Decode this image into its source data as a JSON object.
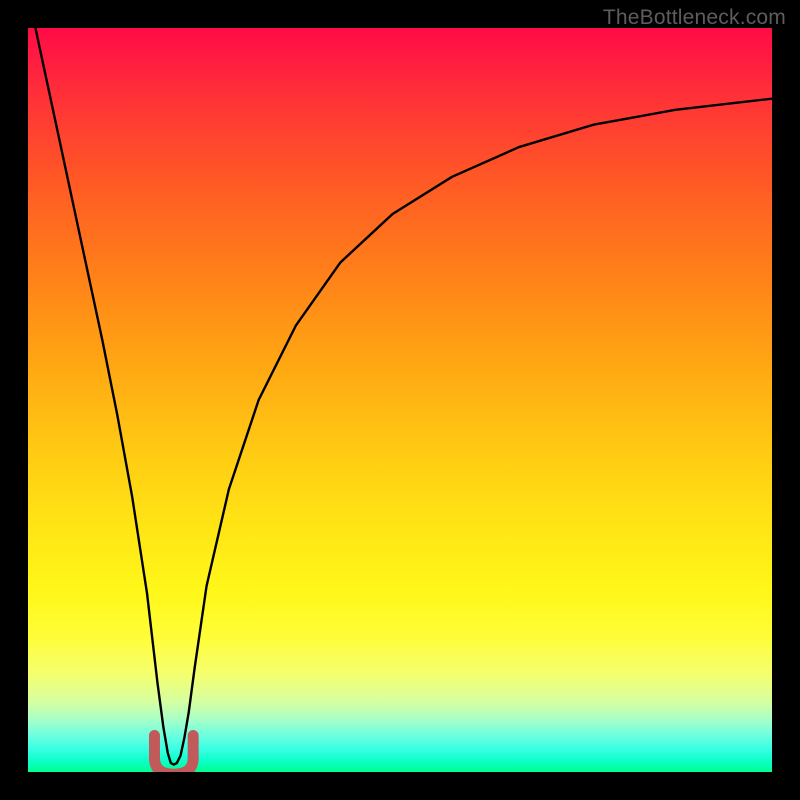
{
  "watermark": "TheBottleneck.com",
  "chart_data": {
    "type": "line",
    "title": "",
    "xlabel": "",
    "ylabel": "",
    "xlim": [
      0,
      100
    ],
    "ylim": [
      0,
      100
    ],
    "grid": false,
    "background": "red-yellow-green vertical gradient",
    "series": [
      {
        "name": "bottleneck-curve",
        "stroke": "#000000",
        "x": [
          1,
          4,
          7,
          10,
          12,
          14,
          16,
          17.4,
          18.2,
          18.8,
          19.2,
          19.6,
          20.0,
          20.5,
          21.0,
          21.6,
          22.4,
          24,
          27,
          31,
          36,
          42,
          49,
          57,
          66,
          76,
          87,
          100
        ],
        "values": [
          100,
          86,
          72,
          58,
          48,
          37,
          24,
          12,
          6,
          2.5,
          1.2,
          1.0,
          1.2,
          2.2,
          4.5,
          8,
          14,
          25,
          38,
          50,
          60,
          68.5,
          75,
          80,
          84,
          87,
          89,
          90.5
        ]
      }
    ],
    "markers": [
      {
        "name": "optimum-marker",
        "shape": "u",
        "color": "#c15b5b",
        "cx": 19.6,
        "cy": 2.3,
        "rx": 2.6,
        "ry": 2.6
      }
    ]
  }
}
